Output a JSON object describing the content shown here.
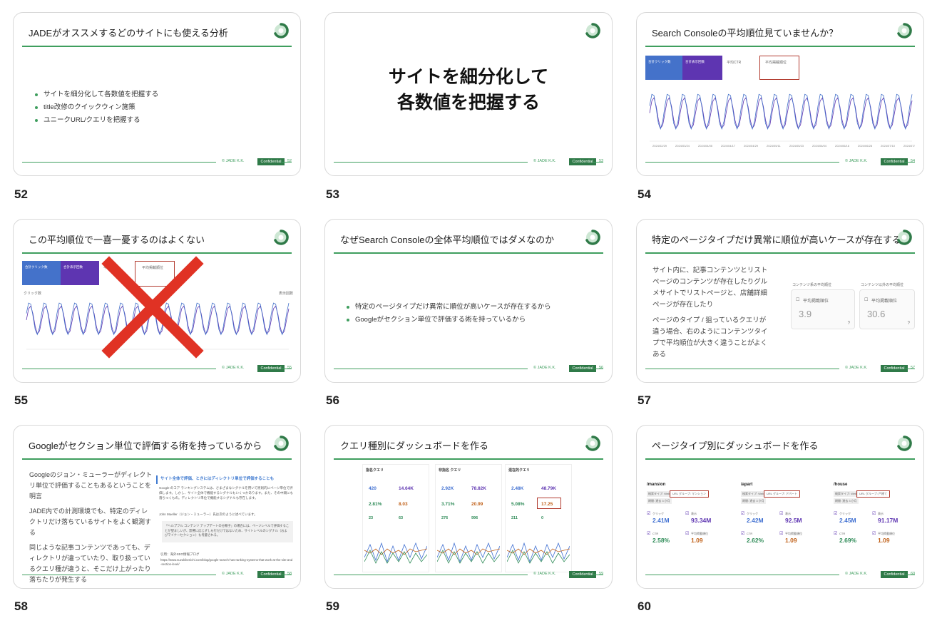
{
  "brand": {
    "accent": "#3f9e5e",
    "badge": "#2f7a48",
    "red": "#b23a2e",
    "gsc_blue": "#4472ca",
    "gsc_purple": "#5e35b1"
  },
  "footer": {
    "company": "© JADE K.K.",
    "confidential": "Confidential"
  },
  "icons": {
    "logo": "jade-logo-icon",
    "checkbox": "checkbox-icon",
    "help": "help-icon",
    "cross": "red-x-icon"
  },
  "slides": [
    {
      "num": "52",
      "title": "JADEがオススメするどのサイトにも使える分析",
      "bullets": [
        "サイトを細分化して各数値を把握する",
        "title改修のクイックウィン施策",
        "ユニークURL/クエリを把握する"
      ]
    },
    {
      "num": "53",
      "heading_line1": "サイトを細分化して",
      "heading_line2": "各数値を把握する"
    },
    {
      "num": "54",
      "title": "Search Consoleの平均順位見ていませんか？",
      "gsc": {
        "tab1": "合計クリック数",
        "tab2": "合計表示回数",
        "tab3": "平均CTR",
        "tab4": "平均掲載順位",
        "xticks": [
          "2024/02/29",
          "2024/03/24",
          "2024/04/05",
          "2024/04/17",
          "2024/04/29",
          "2024/05/11",
          "2024/05/23",
          "2024/06/04",
          "2024/06/16",
          "2024/06/28",
          "2024/07/10",
          "2024/07/22"
        ]
      }
    },
    {
      "num": "55",
      "title": "この平均順位で一喜一憂するのはよくない",
      "gsc": {
        "tab1": "合計クリック数",
        "tab2": "合計表示回数",
        "tab3": "平均 CTR",
        "tab4": "平均掲載順位",
        "yleft": "クリック数",
        "yright": "表示回数"
      }
    },
    {
      "num": "56",
      "title": "なぜSearch Consoleの全体平均順位ではダメなのか",
      "bullets": [
        "特定のページタイプだけ異常に順位が高いケースが存在するから",
        "Googleがセクション単位で評価する術を持っているから"
      ]
    },
    {
      "num": "57",
      "title": "特定のページタイプだけ異常に順位が高いケースが存在する",
      "para1": "サイト内に、記事コンテンツとリストページのコンテンツが存在したりグルメサイトでリストページと、店舗詳細ページが存在したり",
      "para2": "ページのタイプ / 狙っているクエリが違う場合、右のようにコンテンツタイプで平均順位が大きく違うことがよくある",
      "card1": {
        "heading": "コンテンツ系の平均順位",
        "metric": "平均掲載順位",
        "value": "3.9"
      },
      "card2": {
        "heading": "コンテンツ以外の平均順位",
        "metric": "平均掲載順位",
        "value": "30.6"
      }
    },
    {
      "num": "58",
      "title": "Googleがセクション単位で評価する術を持っているから",
      "para1": "Googleのジョン・ミューラーがディレクトリ単位で評価することもあるということを明言",
      "para2": "JADE内での計測環境でも、特定のディレクトリだけ落ちているサイトをよく観測する",
      "para3": "同じような記事コンテンツであっても、ディレクトリが違っていたり、取り扱っているクエリ種が違うと、そこだけ上がったり落ちたりが発生する",
      "quote_title": "サイト全体で評価、ときにはディレクトリ単位で評価することも",
      "quote_body": "Google のコア ランキングシステムは、さまざまなシグナルを用いて原則的にページ単位で評価します。しかし、サイト全体で機能するシグナルもいくつかあります。また、その中間にも落ちつくもの。ディレクトリ単位で機能するシグナルも存在します。",
      "quote_person": "John Mueller（ジョン・ミューラー）氏は次のように述べています。",
      "quote_inner": "「ヘルプフル コンテンツ アップデートの分類子」の場合には、ページレベルで評価することが望ましいが、影響に応じずしも行だけではないため、サイトレベルのシグナル（およびマイナーセクション）も考慮される。",
      "quote_ref": "引用：海外SEO情報ブログ",
      "quote_url": "https://www.suzukikenichi.com/blog/google-search-has-ranking-systems-that-work-at-the-site-and-section-level/"
    },
    {
      "num": "59",
      "title": "クエリ種別にダッシュボードを作る",
      "panels": [
        {
          "name": "指名クエリ",
          "v1": "420",
          "v2": "14.64K",
          "v3": "2.81%",
          "v4": "8.03",
          "v5": "23",
          "v6": "63"
        },
        {
          "name": "非指名 クエリ",
          "v1": "2.92K",
          "v2": "78.82K",
          "v3": "3.71%",
          "v4": "20.99",
          "v5": "276",
          "v6": "996"
        },
        {
          "name": "混在的クエリ",
          "v1": "2.48K",
          "v2": "48.79K",
          "v3": "5.08%",
          "v4": "17.25",
          "v5": "211",
          "v6": "0"
        }
      ]
    },
    {
      "num": "60",
      "title": "ページタイプ別にダッシュボードを作る",
      "panels": [
        {
          "path": "/mansion",
          "filter": "URL グループ: マンション",
          "clicks": "2.41M",
          "impr": "93.34M",
          "ctr": "2.58%",
          "pos": "1.09"
        },
        {
          "path": "/apart",
          "filter": "URL グループ: アパート",
          "clicks": "2.42M",
          "impr": "92.5M",
          "ctr": "2.62%",
          "pos": "1.09"
        },
        {
          "path": "/house",
          "filter": "URL グループ: 戸建て",
          "clicks": "2.45M",
          "impr": "91.17M",
          "ctr": "2.69%",
          "pos": "1.09"
        }
      ]
    }
  ],
  "labels": {
    "clicks": "クリック",
    "impressions": "表示",
    "ctr": "CTR",
    "position": "平均掲載順位",
    "url_group": "URL グループ",
    "search_type": "検索タイプ: Web",
    "period": "期間: 過去 3 か月"
  }
}
